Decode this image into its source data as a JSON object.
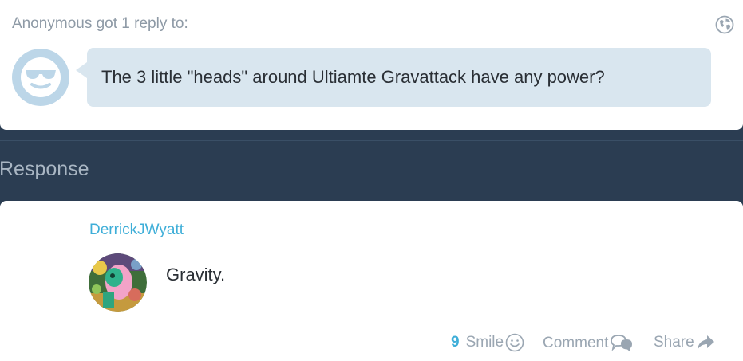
{
  "question": {
    "header": "Anonymous got 1 reply to:",
    "text": "The 3 little \"heads\" around Ultiamte Gravattack have any power?"
  },
  "response_section": {
    "title": "Response"
  },
  "answer": {
    "author": "DerrickJWyatt",
    "text": "Gravity."
  },
  "actions": {
    "smile_count": "9",
    "smile_label": "Smile",
    "comment_label": "Comment",
    "share_label": "Share"
  },
  "icons": {
    "globe": "globe-icon",
    "anonymous_avatar": "cool-face-icon",
    "smile": "smile-icon",
    "comment": "comment-bubbles-icon",
    "share": "share-arrow-icon"
  },
  "colors": {
    "background": "#2b3d52",
    "link": "#3eaed8",
    "bubble": "#d9e6ef",
    "muted": "#9aa6b2"
  }
}
